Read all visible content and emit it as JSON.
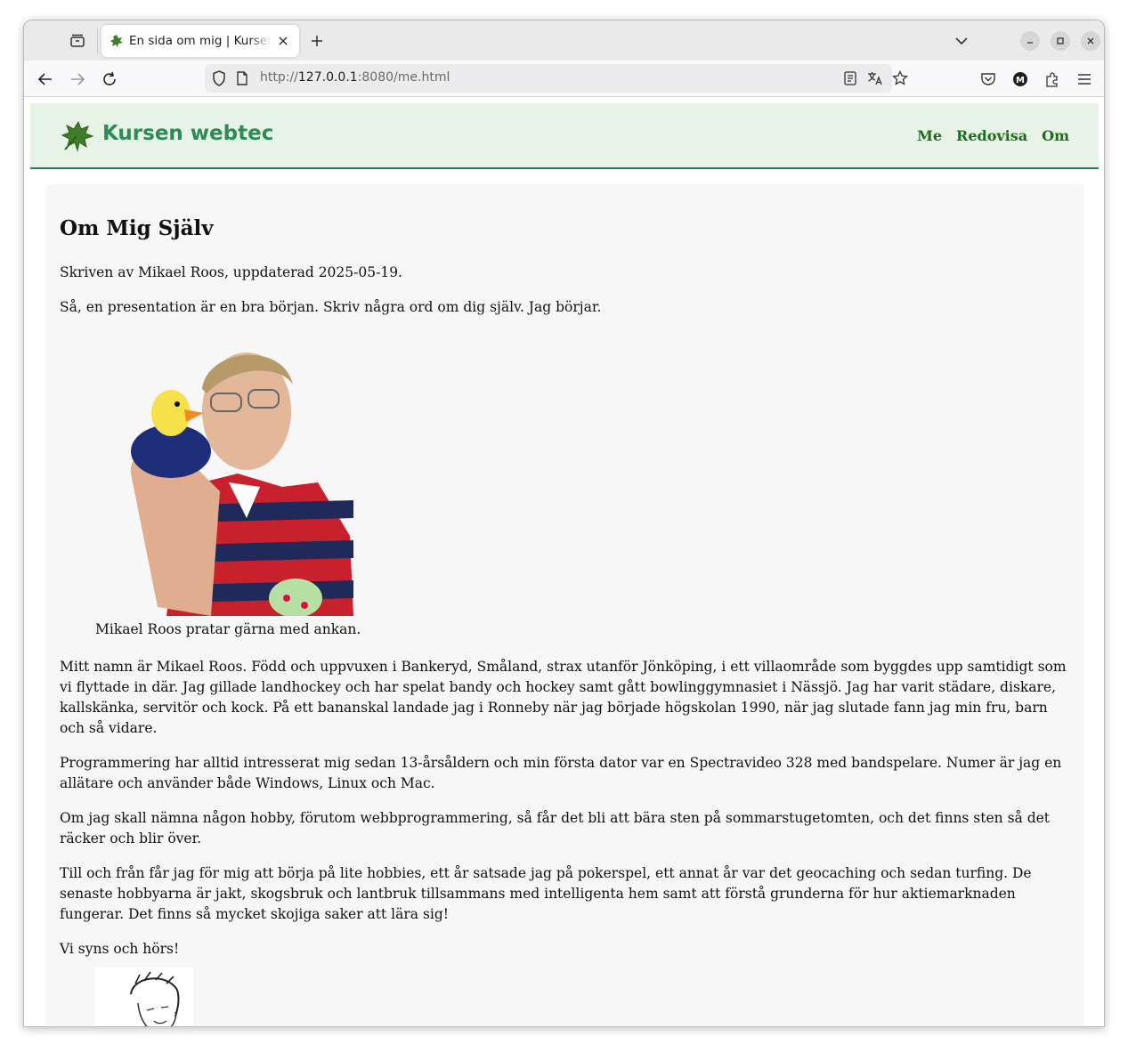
{
  "browser": {
    "tab_title": "En sida om mig | Kursen webtec",
    "url_scheme": "http://",
    "url_host": "127.0.0.1",
    "url_rest": ":8080/me.html"
  },
  "site": {
    "title": "Kursen webtec",
    "nav": [
      "Me",
      "Redovisa",
      "Om"
    ],
    "accent_color": "#2e8b57",
    "header_bg": "#e8f3e8"
  },
  "page": {
    "heading": "Om Mig Själv",
    "byline": "Skriven av Mikael Roos, uppdaterad 2025-05-19.",
    "intro": "Så, en presentation är en bra början. Skriv några ord om dig själv. Jag börjar.",
    "figure_caption": "Mikael Roos pratar gärna med ankan.",
    "paragraphs": [
      "Mitt namn är Mikael Roos. Född och uppvuxen i Bankeryd, Småland, strax utanför Jönköping, i ett villaområde som byggdes upp samtidigt som vi flyttade in där. Jag gillade landhockey och har spelat bandy och hockey samt gått bowlinggymnasiet i Nässjö. Jag har varit städare, diskare, kallskänka, servitör och kock. På ett bananskal landade jag i Ronneby när jag började högskolan 1990, när jag slutade fann jag min fru, barn och så vidare.",
      "Programmering har alltid intresserat mig sedan 13-årsåldern och min första dator var en Spectravideo 328 med bandspelare. Numer är jag en allätare och använder både Windows, Linux och Mac.",
      "Om jag skall nämna någon hobby, förutom webbprogrammering, så får det bli att bära sten på sommarstugetomten, och det finns sten så det räcker och blir över.",
      "Till och från får jag för mig att börja på lite hobbies, ett år satsade jag på pokerspel, ett annat år var det geocaching och sedan turfing. De senaste hobbyarna är jakt, skogsbruk och lantbruk tillsammans med intelligenta hem samt att förstå grunderna för hur aktiemarknaden fungerar. Det finns så mycket skojiga saker att lära sig!",
      "Vi syns och hörs!"
    ]
  }
}
